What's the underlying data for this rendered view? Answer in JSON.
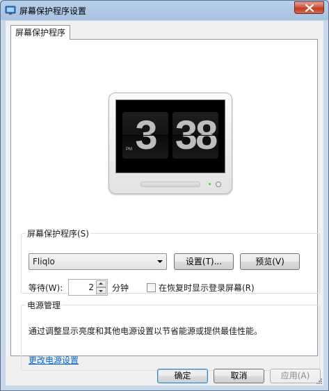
{
  "window": {
    "title": "屏幕保护程序设置"
  },
  "tabs": [
    {
      "label": "屏幕保护程序"
    }
  ],
  "preview": {
    "hour": "3",
    "minute": "38",
    "ampm": "PM"
  },
  "screensaver": {
    "group_label": "屏幕保护程序(S)",
    "selected": "Fliqlo",
    "settings_label": "设置(T)...",
    "preview_label": "预览(V)",
    "wait_label": "等待(W):",
    "wait_value": "2",
    "minutes_label": "分钟",
    "resume_label": "在恢复时显示登录屏幕(R)",
    "resume_checked": false
  },
  "power": {
    "group_label": "电源管理",
    "description": "通过调整显示亮度和其他电源设置以节省能源或提供最佳性能。",
    "link_label": "更改电源设置"
  },
  "footer": {
    "ok_label": "确定",
    "cancel_label": "取消",
    "apply_label": "应用(A)"
  },
  "colors": {
    "link": "#0066cc",
    "close_button": "#c94a30",
    "default_button_border": "#3c7fb1"
  }
}
